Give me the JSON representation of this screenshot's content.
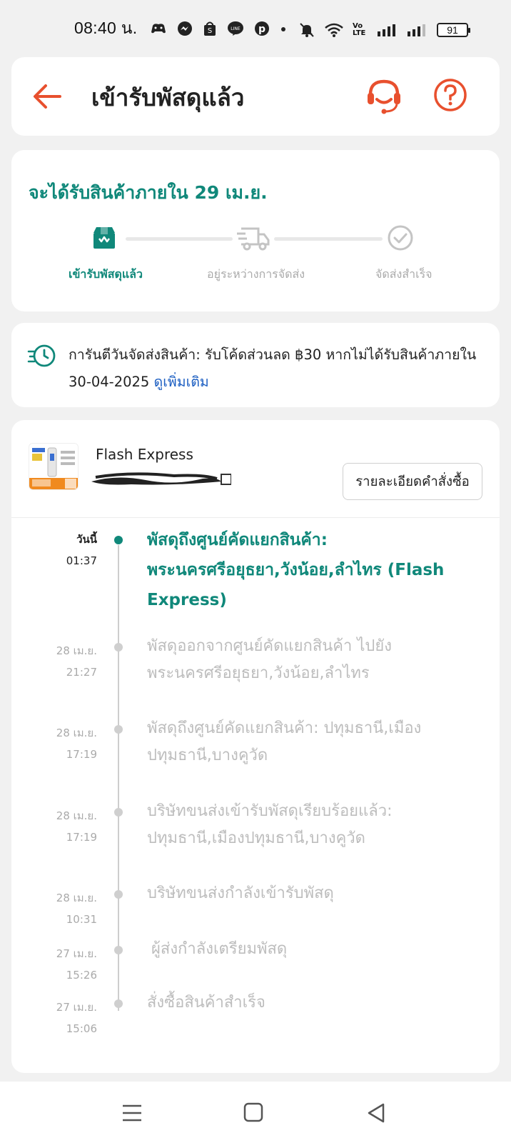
{
  "status_bar": {
    "time": "08:40 น.",
    "battery": "91",
    "network_label": "Vo LTE"
  },
  "header": {
    "title": "เข้ารับพัสดุแล้ว"
  },
  "delivery": {
    "eta": "จะได้รับสินค้าภายใน 29 เม.ย.",
    "steps": [
      {
        "label": "เข้ารับพัสดุแล้ว",
        "state": "done"
      },
      {
        "label": "อยู่ระหว่างการจัดส่ง",
        "state": "pending"
      },
      {
        "label": "จัดส่งสำเร็จ",
        "state": "pending"
      }
    ],
    "accent_color": "#10887a"
  },
  "guarantee": {
    "text": "การันตีวันจัดส่งสินค้า: รับโค้ดส่วนลด ฿30 หากไม่ได้รับสินค้าภายใน 30-04-2025",
    "link": "ดูเพิ่มเติม"
  },
  "shipment": {
    "carrier": "Flash Express",
    "order_detail_button": "รายละเอียดคำสั่งซื้อ"
  },
  "timeline": [
    {
      "date": "วันนี้",
      "time": "01:37",
      "text": "พัสดุถึงศูนย์คัดแยกสินค้า: พระนครศรีอยุธยา,วังน้อย,ลำไทร (Flash Express)",
      "active": true
    },
    {
      "date": "28 เม.ย.",
      "time": "21:27",
      "text": "พัสดุออกจากศูนย์คัดแยกสินค้า ไปยัง พระนครศรีอยุธยา,วังน้อย,ลำไทร",
      "active": false
    },
    {
      "date": "28 เม.ย.",
      "time": "17:19",
      "text": "พัสดุถึงศูนย์คัดแยกสินค้า: ปทุมธานี,เมือง ปทุมธานี,บางคูวัด",
      "active": false
    },
    {
      "date": "28 เม.ย.",
      "time": "17:19",
      "text": "บริษัทขนส่งเข้ารับพัสดุเรียบร้อยแล้ว: ปทุมธานี,เมืองปทุมธานี,บางคูวัด",
      "active": false
    },
    {
      "date": "28 เม.ย.",
      "time": "10:31",
      "text": "บริษัทขนส่งกำลังเข้ารับพัสดุ",
      "active": false
    },
    {
      "date": "27 เม.ย.",
      "time": "15:26",
      "text": "ผู้ส่งกำลังเตรียมพัสดุ",
      "active": false
    },
    {
      "date": "27 เม.ย.",
      "time": "15:06",
      "text": "สั่งซื้อสินค้าสำเร็จ",
      "active": false
    }
  ],
  "colors": {
    "brand_orange": "#e8502e",
    "teal": "#10887a",
    "link_blue": "#1d5fc2"
  }
}
